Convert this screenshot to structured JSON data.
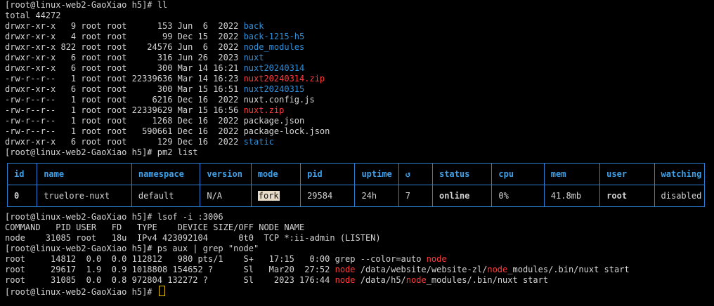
{
  "terminal": {
    "prompt_ll": "[root@linux-web2-GaoXiao h5]# ll",
    "total": "total 44272",
    "listing": [
      {
        "meta": "drwxr-xr-x   9 root root      153 Jun  6  2022 ",
        "name": "back",
        "kind": "dir"
      },
      {
        "meta": "drwxr-xr-x   4 root root       99 Dec 15  2022 ",
        "name": "back-1215-h5",
        "kind": "dir"
      },
      {
        "meta": "drwxr-xr-x 822 root root    24576 Jun  6  2022 ",
        "name": "node_modules",
        "kind": "dir"
      },
      {
        "meta": "drwxr-xr-x   6 root root      316 Jun 26  2023 ",
        "name": "nuxt",
        "kind": "dir"
      },
      {
        "meta": "drwxr-xr-x   6 root root      300 Mar 14 16:21 ",
        "name": "nuxt20240314",
        "kind": "dir"
      },
      {
        "meta": "-rw-r--r--   1 root root 22339636 Mar 14 16:23 ",
        "name": "nuxt20240314.zip",
        "kind": "zip"
      },
      {
        "meta": "drwxr-xr-x   6 root root      300 Mar 15 16:51 ",
        "name": "nuxt20240315",
        "kind": "dir"
      },
      {
        "meta": "-rw-r--r--   1 root root     6216 Dec 16  2022 ",
        "name": "nuxt.config.js",
        "kind": "file"
      },
      {
        "meta": "-rw-r--r--   1 root root 22339629 Mar 15 16:56 ",
        "name": "nuxt.zip",
        "kind": "zip"
      },
      {
        "meta": "-rw-r--r--   1 root root     1268 Dec 16  2022 ",
        "name": "package.json",
        "kind": "file"
      },
      {
        "meta": "-rw-r--r--   1 root root   590661 Dec 16  2022 ",
        "name": "package-lock.json",
        "kind": "file"
      },
      {
        "meta": "drwxr-xr-x   6 root root      129 Dec 16  2022 ",
        "name": "static",
        "kind": "dir"
      }
    ],
    "prompt_pm2": "[root@linux-web2-GaoXiao h5]# pm2 list",
    "pm2_headers": [
      "id",
      "name",
      "namespace",
      "version",
      "mode",
      "pid",
      "uptime",
      "↺",
      "status",
      "cpu",
      "mem",
      "user",
      "watching"
    ],
    "pm2_row": [
      "0",
      "truelore-nuxt",
      "default",
      "N/A",
      "fork",
      "29584",
      "24h",
      "7",
      "online",
      "0%",
      "41.8mb",
      "root",
      "disabled"
    ],
    "prompt_lsof": "[root@linux-web2-GaoXiao h5]# lsof -i :3006",
    "lsof_header": "COMMAND   PID USER   FD   TYPE    DEVICE SIZE/OFF NODE NAME",
    "lsof_row": "node    31085 root   18u  IPv4 423092104      0t0  TCP *:ii-admin (LISTEN)",
    "prompt_ps": "[root@linux-web2-GaoXiao h5]# ps aux | grep \"node\"",
    "ps_rows": [
      {
        "pre": "root     14812  0.0  0.0 112812   980 pts/1    S+   17:15   0:00 grep --color=auto ",
        "hl1": "node",
        "mid": "",
        "hl2": "",
        "post": ""
      },
      {
        "pre": "root     29617  1.9  0.9 1018808 154652 ?      Sl   Mar20  27:52 ",
        "hl1": "node",
        "mid": " /data/website/website-zl/",
        "hl2": "node",
        "post": "_modules/.bin/nuxt start"
      },
      {
        "pre": "root     31085  0.0  0.8 972804 132272 ?       Sl    2023 176:44 ",
        "hl1": "node",
        "mid": " /data/h5/",
        "hl2": "node",
        "post": "_modules/.bin/nuxt start"
      }
    ],
    "prompt_final": "[root@linux-web2-GaoXiao h5]# "
  },
  "colors": {
    "background": "#000000",
    "text": "#d4d4d4",
    "directory": "#2f8fd8",
    "archive": "#ff3c3c",
    "online": "#2fd02f",
    "table_border": "#2a7fd4"
  }
}
